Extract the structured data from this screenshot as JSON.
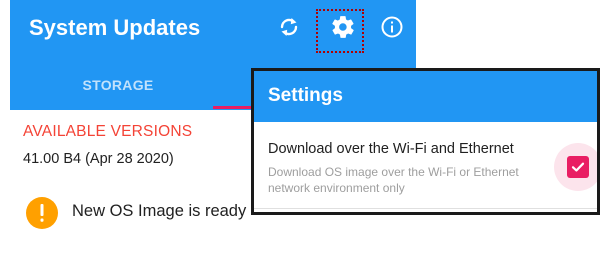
{
  "app": {
    "title": "System Updates",
    "icons": {
      "sync": "sync-icon",
      "settings": "gear-icon",
      "info": "info-icon"
    },
    "colors": {
      "primary": "#2196f3",
      "accent": "#e91e63",
      "highlight": "#b00000",
      "warning": "#ffa000",
      "section": "#f44336"
    }
  },
  "tabs": {
    "storage_label": "STORAGE"
  },
  "main": {
    "section_title": "AVAILABLE VERSIONS",
    "version": "41.00 B4 (Apr 28 2020)",
    "alert_text": "New OS Image is ready"
  },
  "settings_dialog": {
    "title": "Settings",
    "option_title": "Download over the Wi-Fi and Ethernet",
    "option_description": "Download OS image over the Wi-Fi or Ethernet network environment only",
    "checked": true
  }
}
